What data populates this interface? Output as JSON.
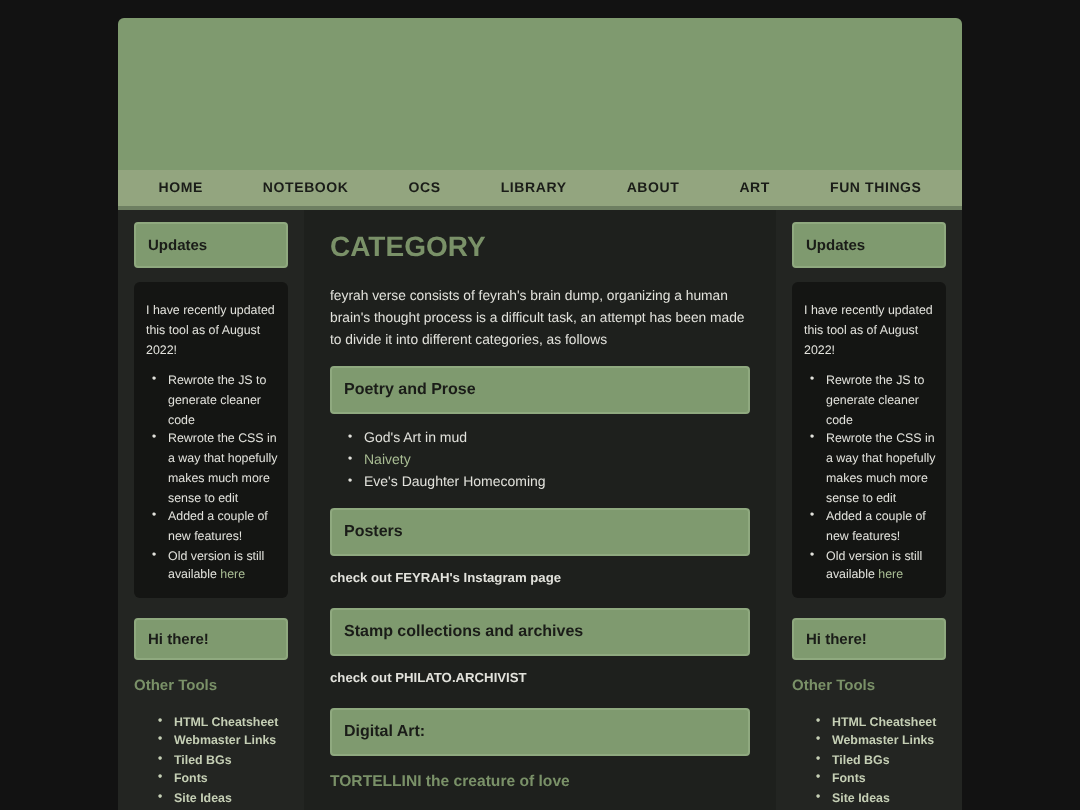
{
  "nav": [
    {
      "label": "HOME"
    },
    {
      "label": "NOTEBOOK"
    },
    {
      "label": "OCS"
    },
    {
      "label": "LIBRARY"
    },
    {
      "label": "ABOUT"
    },
    {
      "label": "ART"
    },
    {
      "label": "FUN THINGS"
    }
  ],
  "sidebars": [
    {
      "marker": "•",
      "updates_title": "Updates",
      "updates_intro": "I have recently updated this tool as of August 2022!",
      "updates_items": [
        {
          "text": "Rewrote the JS to generate cleaner code"
        },
        {
          "text": "Rewrote the CSS in a way that hopefully makes much more sense to edit"
        },
        {
          "text": "Added a couple of new features!"
        },
        {
          "text": "Old version is still available",
          "link": "here"
        }
      ],
      "hi_title": "Hi there!",
      "tools_title": "Other Tools",
      "tools": [
        "HTML Cheatsheet",
        "Webmaster Links",
        "Tiled BGs",
        "Fonts",
        "Site Ideas"
      ]
    },
    {
      "marker": "•",
      "updates_title": "Updates",
      "updates_intro": "I have recently updated this tool as of August 2022!",
      "updates_items": [
        {
          "text": "Rewrote the JS to generate cleaner code"
        },
        {
          "text": "Rewrote the CSS in a way that hopefully makes much more sense to edit"
        },
        {
          "text": "Added a couple of new features!"
        },
        {
          "text": "Old version is still available",
          "link": "here"
        }
      ],
      "hi_title": "Hi there!",
      "tools_title": "Other Tools",
      "tools": [
        "HTML Cheatsheet",
        "Webmaster Links",
        "Tiled BGs",
        "Fonts",
        "Site Ideas"
      ]
    }
  ],
  "main": {
    "title": "CATEGORY",
    "intro": "feyrah verse consists of feyrah's brain dump, organizing a human brain's thought process is a difficult task, an attempt has been made to divide it into different categories, as follows",
    "sections": [
      {
        "heading": "Poetry and Prose",
        "kind": "list",
        "marker": "•",
        "items": [
          {
            "text": "God's Art in mud",
            "link": false
          },
          {
            "text": "Naivety",
            "link": true
          },
          {
            "text": "Eve's Daughter Homecoming",
            "link": false
          }
        ]
      },
      {
        "heading": "Posters",
        "kind": "note",
        "text": "check out FEYRAH's Instagram page"
      },
      {
        "heading": "Stamp collections and archives",
        "kind": "note",
        "text": "check out PHILATO.ARCHIVIST"
      },
      {
        "heading": "Digital Art:",
        "kind": "feature",
        "text": "TORTELLINI the creature of love"
      }
    ]
  }
}
